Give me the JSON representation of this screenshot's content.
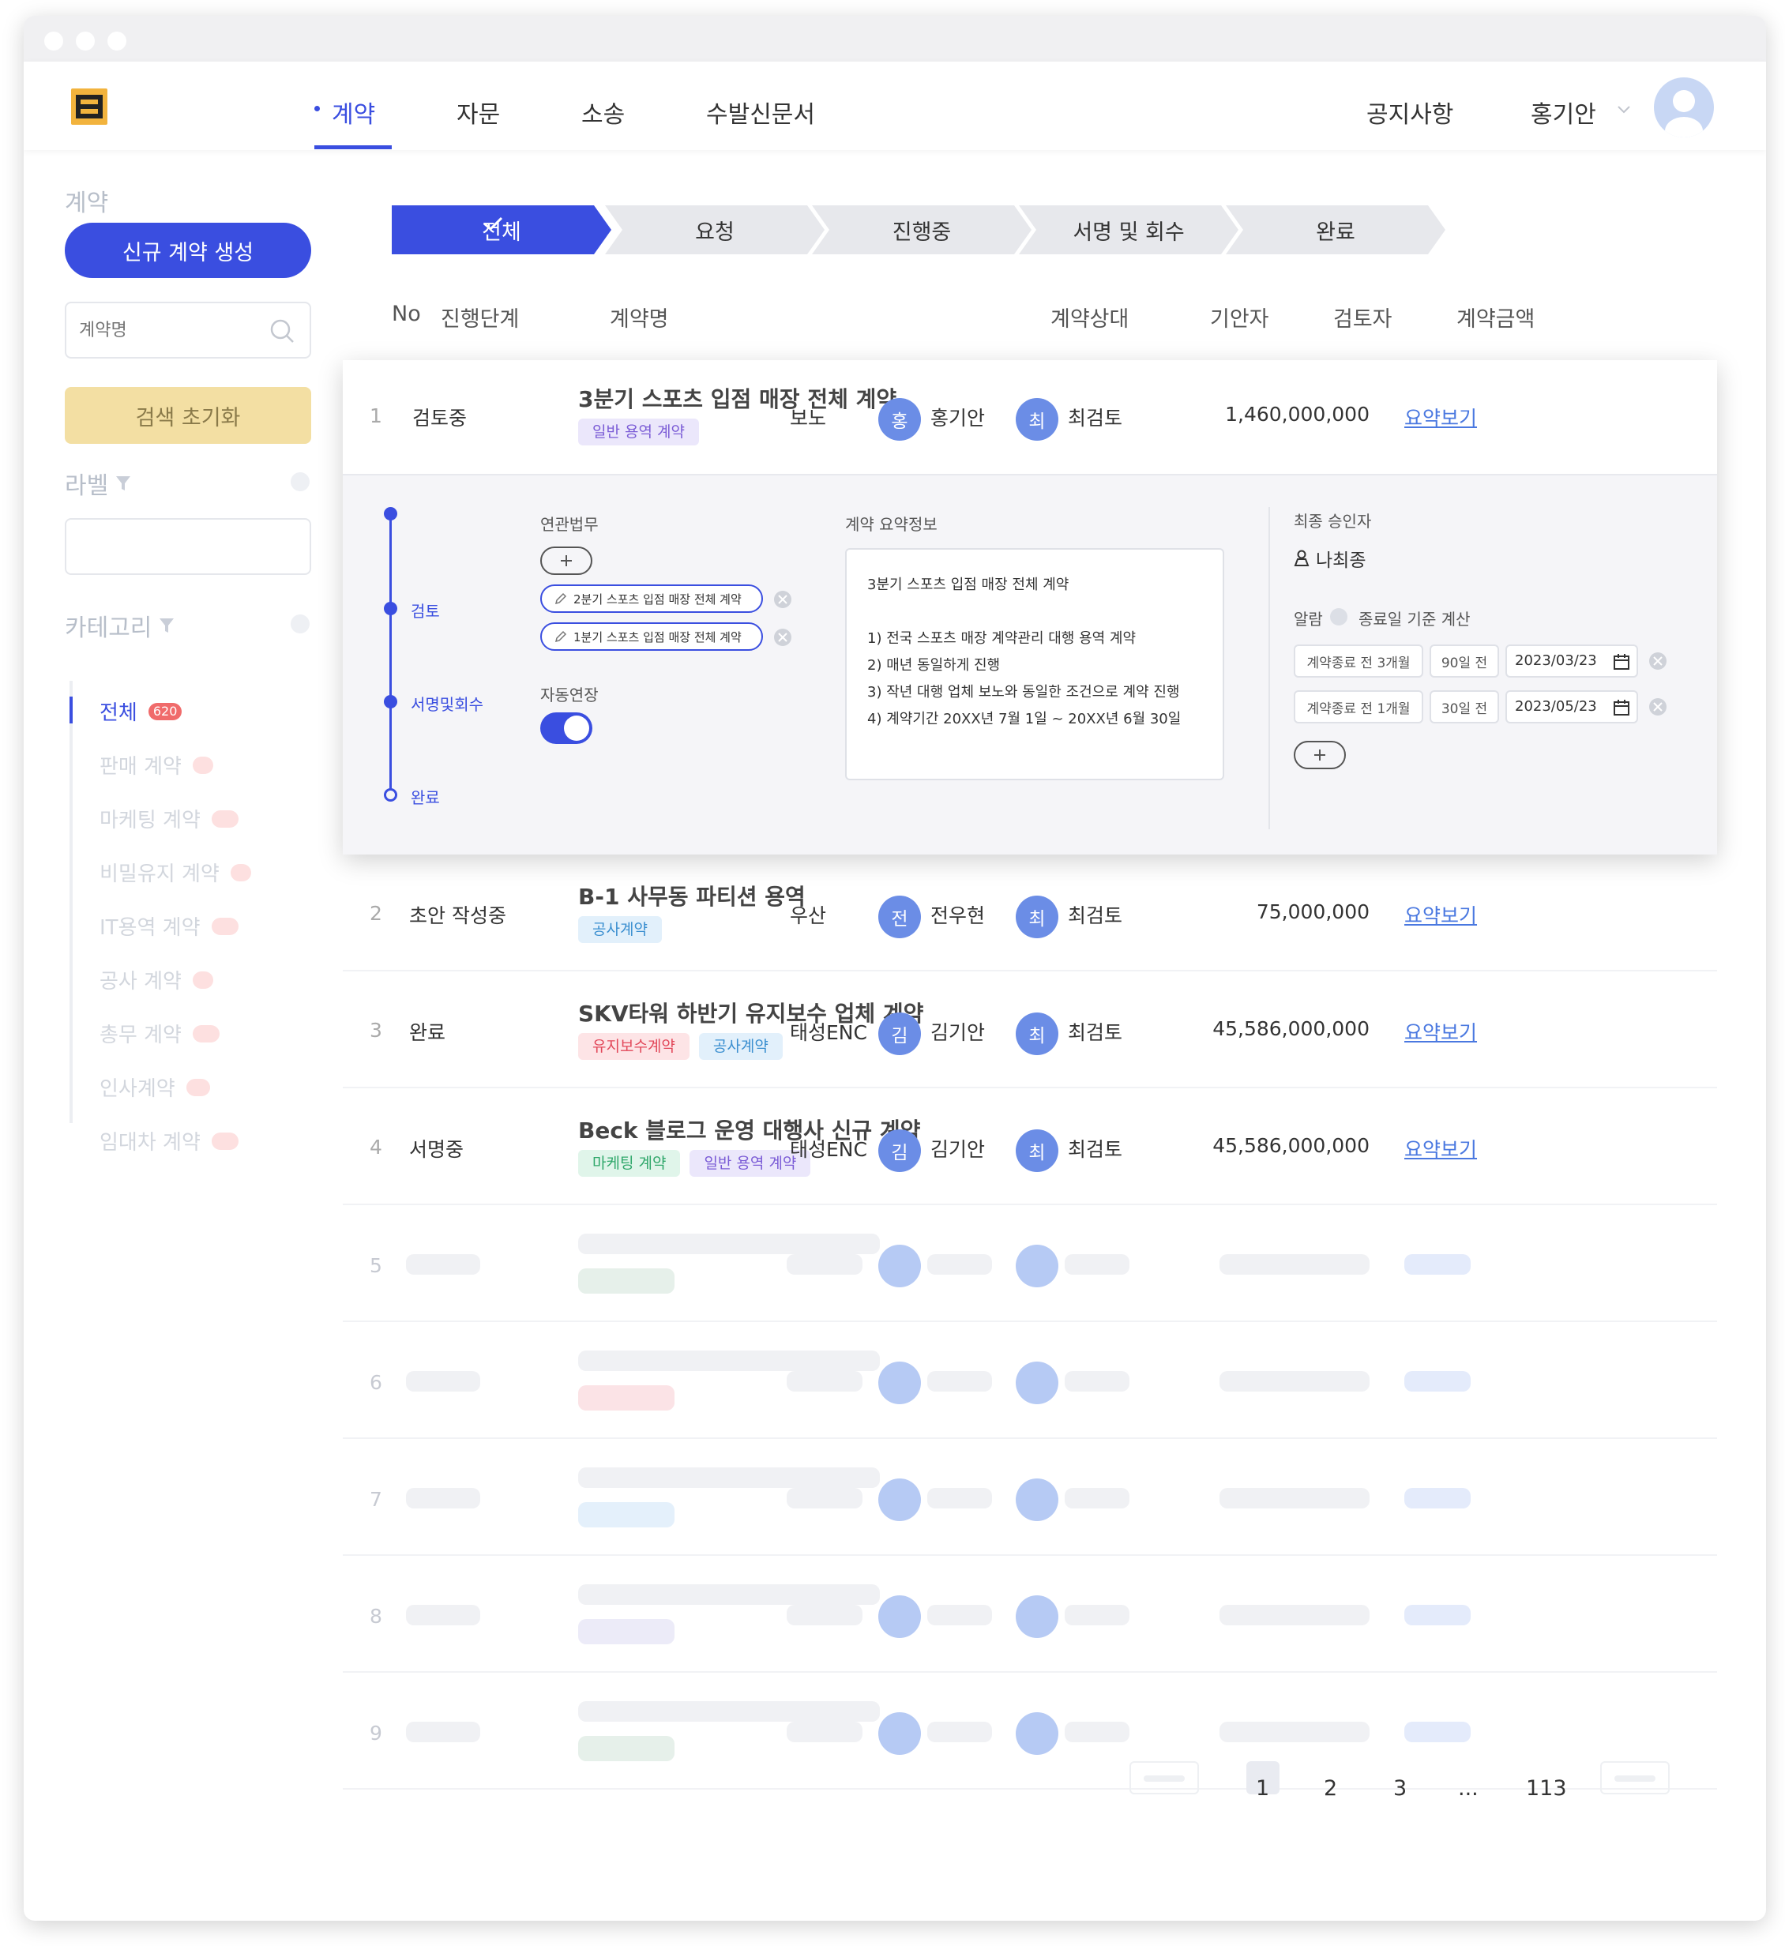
{
  "header": {
    "nav": [
      "계약",
      "자문",
      "소송",
      "수발신문서"
    ],
    "right": {
      "notice": "공지사항",
      "user": "홍기안"
    }
  },
  "sidebar": {
    "section_title": "계약",
    "new_button": "신규 계약 생성",
    "search_placeholder": "계약명",
    "reset_button": "검색 초기화",
    "label_title": "라벨",
    "category_title": "카테고리",
    "categories": [
      {
        "label": "전체",
        "count": "620"
      },
      {
        "label": "판매 계약"
      },
      {
        "label": "마케팅 계약"
      },
      {
        "label": "비밀유지 계약"
      },
      {
        "label": "IT용역 계약"
      },
      {
        "label": "공사 계약"
      },
      {
        "label": "총무 계약"
      },
      {
        "label": "인사계약"
      },
      {
        "label": "임대차 계약"
      }
    ]
  },
  "steps": [
    "전체",
    "요청",
    "진행중",
    "서명 및 회수",
    "완료"
  ],
  "table": {
    "headers": [
      "No",
      "진행단계",
      "계약명",
      "계약상대",
      "기안자",
      "검토자",
      "계약금액"
    ],
    "rows": [
      {
        "no": "1",
        "stage": "검토중",
        "title": "3분기 스포츠 입점 매장 전체 계약",
        "tags": [
          "일반 용역 계약"
        ],
        "partner": "보노",
        "drafter_initial": "홍",
        "drafter": "홍기안",
        "reviewer_initial": "최",
        "reviewer": "최검토",
        "amount": "1,460,000,000",
        "link": "요약보기"
      },
      {
        "no": "2",
        "stage": "초안 작성중",
        "title": "B-1 사무동 파티션 용역",
        "tags": [
          "공사계약"
        ],
        "partner": "우산",
        "drafter_initial": "전",
        "drafter": "전우현",
        "reviewer_initial": "최",
        "reviewer": "최검토",
        "amount": "75,000,000",
        "link": "요약보기"
      },
      {
        "no": "3",
        "stage": "완료",
        "title": "SKV타워 하반기 유지보수 업체 계약",
        "tags": [
          "유지보수계약",
          "공사계약"
        ],
        "partner": "태성ENC",
        "drafter_initial": "김",
        "drafter": "김기안",
        "reviewer_initial": "최",
        "reviewer": "최검토",
        "amount": "45,586,000,000",
        "link": "요약보기"
      },
      {
        "no": "4",
        "stage": "서명중",
        "title": "Beck 블로그 운영 대행사 신규 계약",
        "tags": [
          "마케팅 계약",
          "일반 용역 계약"
        ],
        "partner": "태성ENC",
        "drafter_initial": "김",
        "drafter": "김기안",
        "reviewer_initial": "최",
        "reviewer": "최검토",
        "amount": "45,586,000,000",
        "link": "요약보기"
      }
    ],
    "placeholder_numbers": [
      "5",
      "6",
      "7",
      "8",
      "9"
    ]
  },
  "detail": {
    "timeline": [
      "검토",
      "서명및회수",
      "완료"
    ],
    "related_title": "연관법무",
    "related_items": [
      "2분기 스포츠 입점 매장 전체 계약",
      "1분기 스포츠 입점 매장 전체 계약"
    ],
    "auto_renew_label": "자동연장",
    "auto_renew_on": true,
    "summary_title": "계약 요약정보",
    "summary_lines": [
      "3분기 스포츠 입점 매장 전체 계약",
      "",
      "1) 전국 스포츠 매장 계약관리 대행 용역 계약",
      "2) 매년 동일하게 진행",
      "3) 작년 대행 업체 보노와 동일한 조건으로 계약 진행",
      "4) 계약기간 20XX년 7월 1일 ~ 20XX년 6월 30일"
    ],
    "approver_title": "최종 승인자",
    "approver": "나최종",
    "alarm_label": "알람",
    "alarm_basis": "종료일 기준 계산",
    "alarms": [
      {
        "type": "계약종료 전 3개월",
        "days": "90일 전",
        "date": "2023/03/23"
      },
      {
        "type": "계약종료 전 1개월",
        "days": "30일 전",
        "date": "2023/05/23"
      }
    ]
  },
  "pagination": {
    "pages": [
      "1",
      "2",
      "3",
      "...",
      "113"
    ],
    "current": "1"
  },
  "colors": {
    "accent": "#3a4ee0",
    "link": "#4a78e0",
    "reset": "#f3dfa3"
  }
}
